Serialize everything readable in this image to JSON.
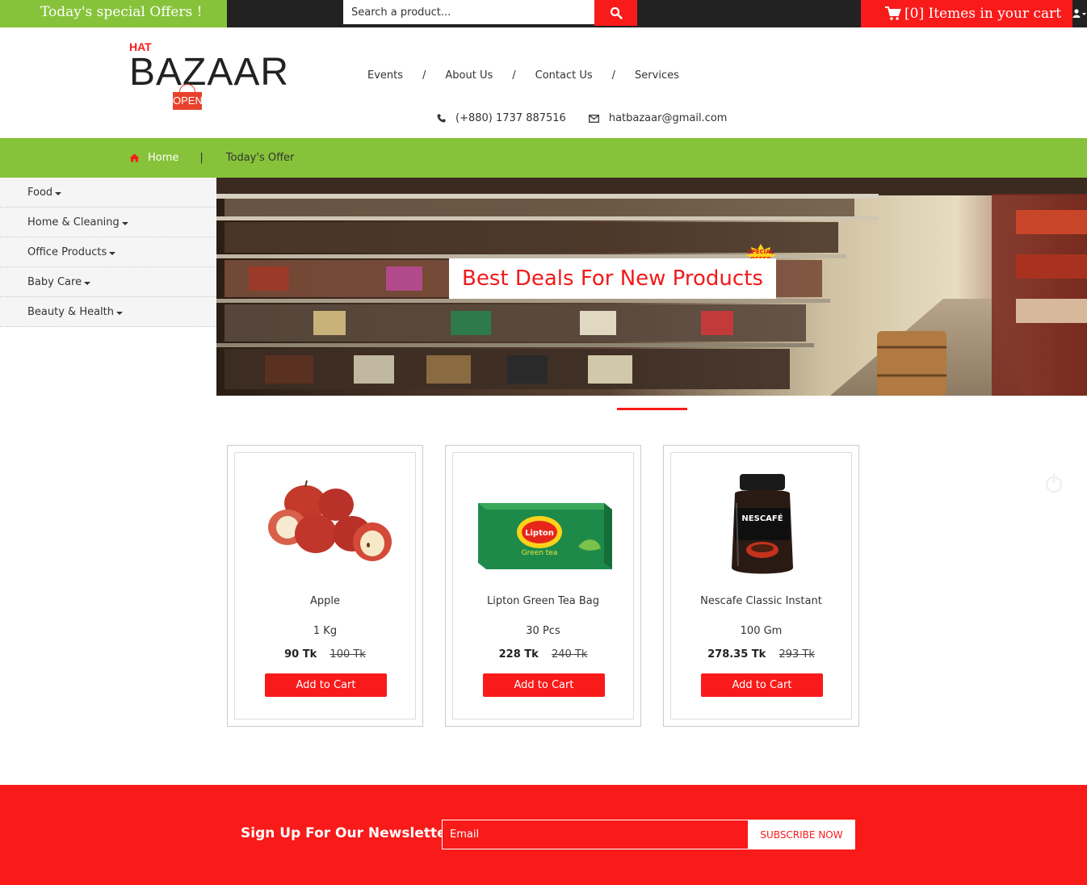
{
  "topbar": {
    "special_offers": "Today's special Offers !",
    "search_placeholder": "Search a product...",
    "cart_label": "[0] Itemes in your cart"
  },
  "logo": {
    "small": "HAT",
    "main": "BAZAAR",
    "sign": "OPEN"
  },
  "nav": {
    "items": [
      "Events",
      "About Us",
      "Contact Us",
      "Services"
    ],
    "separator": "/"
  },
  "contact": {
    "phone": "(+880) 1737 887516",
    "email": "hatbazaar@gmail.com"
  },
  "breadcrumb": {
    "home": "Home",
    "separator": "|",
    "current": "Today's Offer"
  },
  "sidebar": {
    "items": [
      "Food",
      "Home & Cleaning",
      "Office Products",
      "Baby Care",
      "Beauty & Health"
    ]
  },
  "banner": {
    "caption": "Best Deals For New Products",
    "badge": "SPECIAL OFFER"
  },
  "products": [
    {
      "name": "Apple",
      "quantity": "1 Kg",
      "price": "90 Tk",
      "old_price": "100 Tk",
      "button": "Add to Cart"
    },
    {
      "name": "Lipton Green Tea Bag",
      "quantity": "30 Pcs",
      "price": "228 Tk",
      "old_price": "240 Tk",
      "button": "Add to Cart"
    },
    {
      "name": "Nescafe Classic Instant",
      "quantity": "100 Gm",
      "price": "278.35 Tk",
      "old_price": "293 Tk",
      "button": "Add to Cart"
    }
  ],
  "product_images": {
    "lipton_brand": "Lipton",
    "lipton_sub": "Green tea",
    "nescafe_brand": "NESCAFÉ"
  },
  "newsletter": {
    "title": "Sign Up For Our Newsletter",
    "placeholder": "Email",
    "button": "SUBSCRIBE NOW"
  },
  "colors": {
    "brand_red": "#f91a1a",
    "brand_green": "#86c33a",
    "dark": "#222222"
  }
}
